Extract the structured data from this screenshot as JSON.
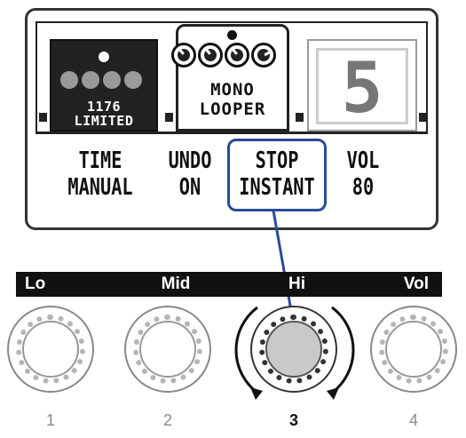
{
  "screen": {
    "effects": [
      {
        "name_line1": "1176",
        "name_line2": "LIMITED"
      },
      {
        "name_line1": "MONO",
        "name_line2": "LOOPER"
      },
      {
        "name_line1": "5"
      }
    ],
    "params": [
      {
        "label": "TIME",
        "value": "MANUAL"
      },
      {
        "label": "UNDO",
        "value": "ON"
      },
      {
        "label": "STOP",
        "value": "INSTANT"
      },
      {
        "label": "VOL",
        "value": "80"
      }
    ]
  },
  "knob_bar": {
    "labels": [
      "Lo",
      "Mid",
      "Hi",
      "Vol"
    ]
  },
  "knobs": [
    {
      "number": "1",
      "active": false
    },
    {
      "number": "2",
      "active": false
    },
    {
      "number": "3",
      "active": true
    },
    {
      "number": "4",
      "active": false
    }
  ],
  "colors": {
    "highlight": "#2c4a9c",
    "bar": "#111111"
  },
  "icons": {
    "rotation": "rotate-arrows-icon"
  }
}
